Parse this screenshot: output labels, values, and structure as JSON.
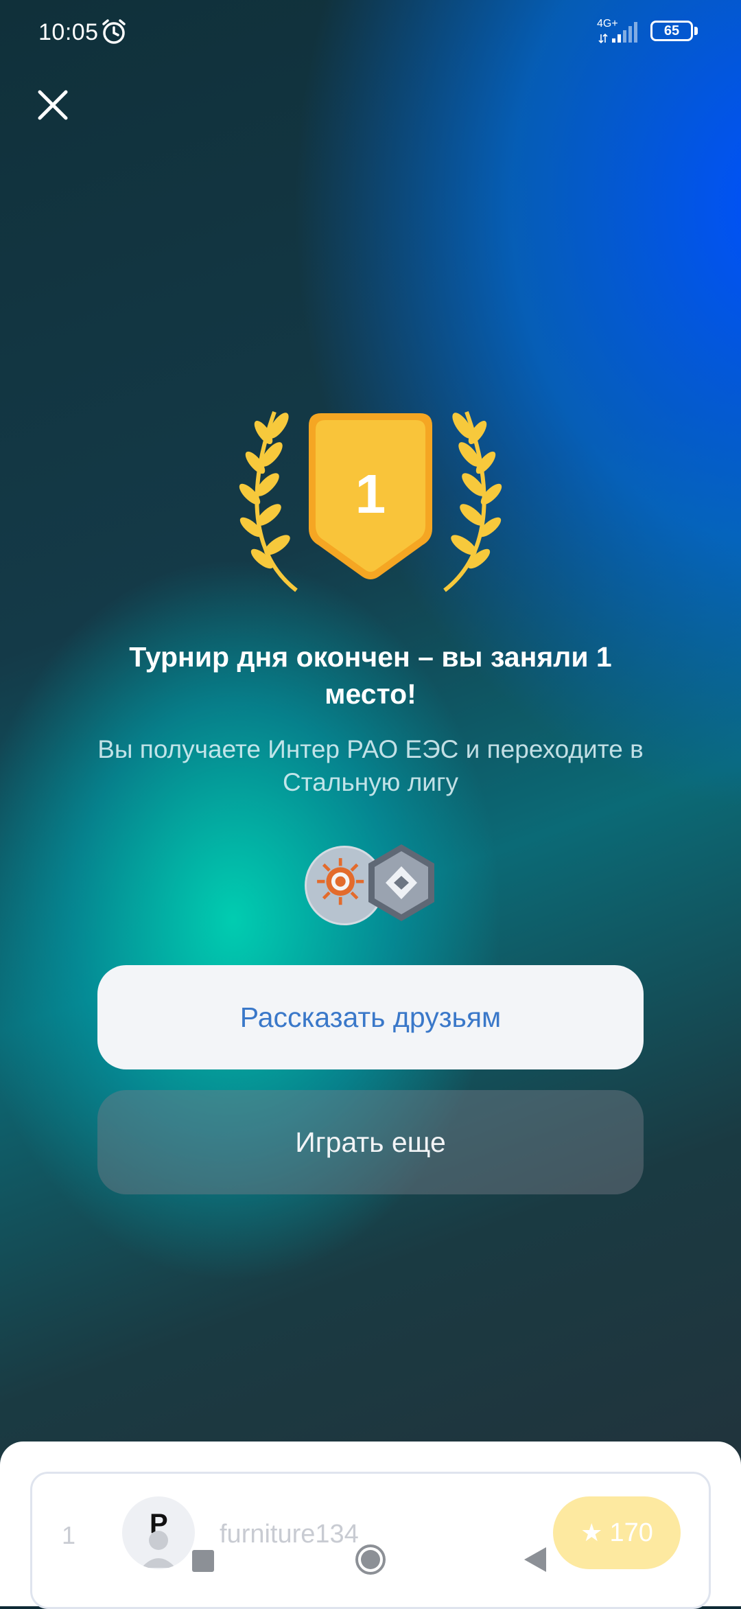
{
  "status_bar": {
    "time": "10:05",
    "network": "4G+",
    "battery": "65"
  },
  "icons": {
    "close": "close-icon",
    "alarm": "alarm-icon",
    "signal": "signal-icon",
    "trophy": "trophy-laurel-icon",
    "coin": "inter-rao-coin-icon",
    "league": "steel-league-icon",
    "star": "star-icon"
  },
  "result": {
    "place": "1",
    "title": "Турнир дня окончен – вы заняли 1 место!",
    "subtitle": "Вы получаете Интер РАО ЕЭС и переходите в Стальную лигу"
  },
  "buttons": {
    "share_label": "Рассказать друзьям",
    "play_label": "Играть еще"
  },
  "leaderboard": {
    "rank": "1",
    "avatar_letter": "P",
    "username": "furniture134",
    "score": "170"
  },
  "colors": {
    "gold": "#f7b92a",
    "share_text": "#3a78c9",
    "button_light": "#f3f5f8"
  }
}
